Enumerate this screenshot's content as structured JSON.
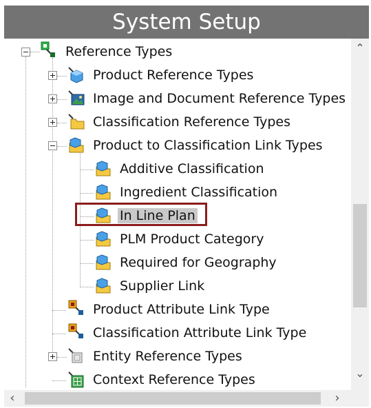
{
  "title": "System Setup",
  "tree": {
    "root_label": "Reference Types",
    "items": [
      {
        "label": "Product Reference Types",
        "icon": "cube-blue-icon"
      },
      {
        "label": "Image and Document Reference Types",
        "icon": "image-icon"
      },
      {
        "label": "Classification Reference Types",
        "icon": "folder-icon"
      },
      {
        "label": "Product to Classification Link Types",
        "icon": "link-folder-icon",
        "children": [
          {
            "label": "Additive Classification"
          },
          {
            "label": "Ingredient Classification"
          },
          {
            "label": "In Line Plan",
            "selected": true
          },
          {
            "label": "PLM Product Category"
          },
          {
            "label": "Required for Geography"
          },
          {
            "label": "Supplier Link"
          }
        ]
      },
      {
        "label": "Product Attribute Link Type",
        "icon": "attribute-link-icon"
      },
      {
        "label": "Classification Attribute Link Type",
        "icon": "attribute-link-icon"
      },
      {
        "label": "Entity Reference Types",
        "icon": "entity-icon"
      },
      {
        "label": "Context Reference Types",
        "icon": "context-icon"
      }
    ]
  },
  "colors": {
    "selection_border": "#8b1c1c",
    "title_bg": "#737373",
    "selected_bg": "#c9c9c9"
  }
}
